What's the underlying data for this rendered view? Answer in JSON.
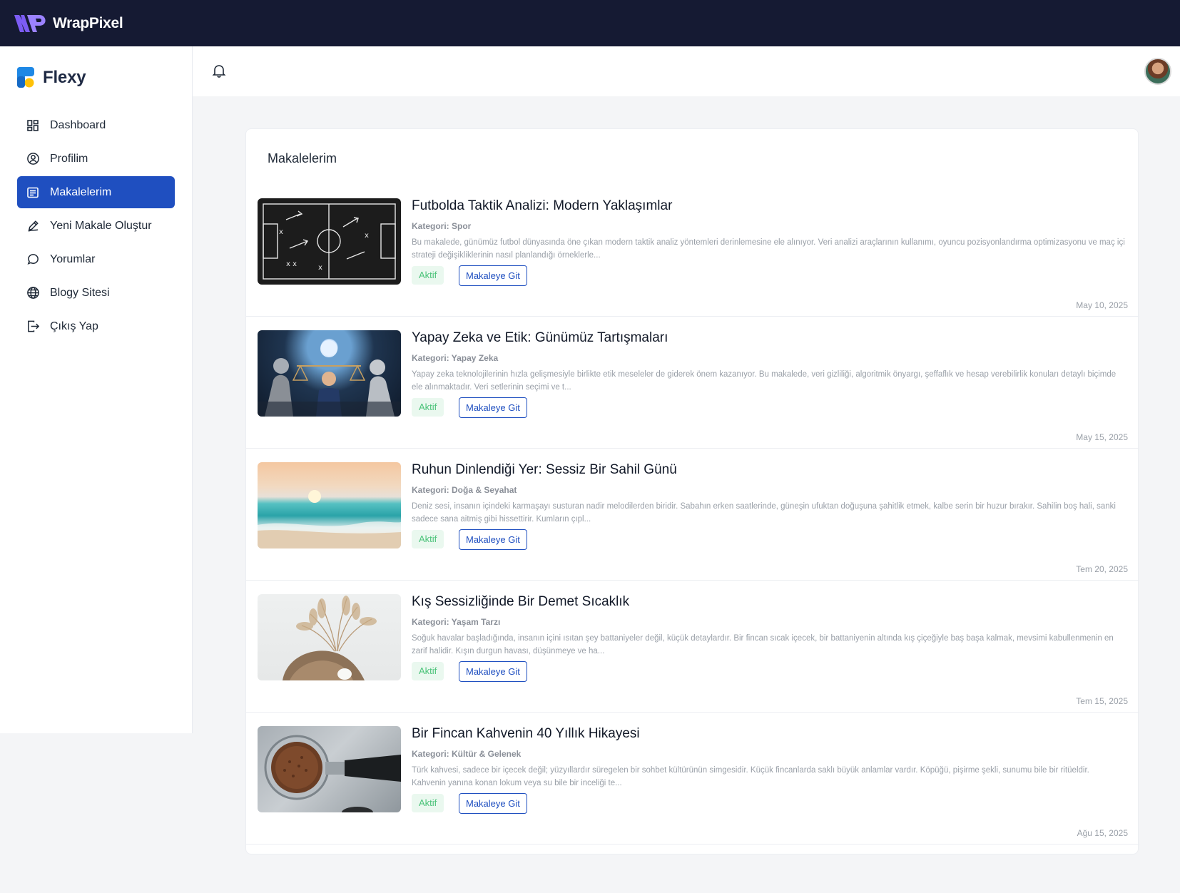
{
  "topbar": {
    "brand": "WrapPixel"
  },
  "sidebar": {
    "brand": "Flexy",
    "items": [
      {
        "label": "Dashboard",
        "icon": "dashboard-icon"
      },
      {
        "label": "Profilim",
        "icon": "user-circle-icon"
      },
      {
        "label": "Makalelerim",
        "icon": "article-icon",
        "active": true
      },
      {
        "label": "Yeni Makale Oluştur",
        "icon": "pencil-icon"
      },
      {
        "label": "Yorumlar",
        "icon": "comment-icon"
      },
      {
        "label": "Blogy Sitesi",
        "icon": "globe-icon"
      },
      {
        "label": "Çıkış Yap",
        "icon": "logout-icon"
      }
    ]
  },
  "header": {
    "bell_icon": "bell-icon",
    "avatar": "user-avatar"
  },
  "main": {
    "title": "Makalelerim",
    "articles": [
      {
        "title": "Futbolda Taktik Analizi: Modern Yaklaşımlar",
        "category": "Kategori: Spor",
        "description": "Bu makalede, günümüz futbol dünyasında öne çıkan modern taktik analiz yöntemleri derinlemesine ele alınıyor. Veri analizi araçlarının kullanımı, oyuncu pozisyonlandırma optimizasyonu ve maç içi strateji değişikliklerinin nasıl planlandığı örneklerle...",
        "status": "Aktif",
        "button": "Makaleye Git",
        "date": "May 10, 2025"
      },
      {
        "title": "Yapay Zeka ve Etik: Günümüz Tartışmaları",
        "category": "Kategori: Yapay Zeka",
        "description": "Yapay zeka teknolojilerinin hızla gelişmesiyle birlikte etik meseleler de giderek önem kazanıyor. Bu makalede, veri gizliliği, algoritmik önyargı, şeffaflık ve hesap verebilirlik konuları detaylı biçimde ele alınmaktadır. Veri setlerinin seçimi ve t...",
        "status": "Aktif",
        "button": "Makaleye Git",
        "date": "May 15, 2025"
      },
      {
        "title": "Ruhun Dinlendiği Yer: Sessiz Bir Sahil Günü",
        "category": "Kategori: Doğa & Seyahat",
        "description": "Deniz sesi, insanın içindeki karmaşayı susturan nadir melodilerden biridir. Sabahın erken saatlerinde, güneşin ufuktan doğuşuna şahitlik etmek, kalbe serin bir huzur bırakır. Sahilin boş hali, sanki sadece sana aitmiş gibi hissettirir. Kumların çıpl...",
        "status": "Aktif",
        "button": "Makaleye Git",
        "date": "Tem 20, 2025"
      },
      {
        "title": "Kış Sessizliğinde Bir Demet Sıcaklık",
        "category": "Kategori: Yaşam Tarzı",
        "description": "Soğuk havalar başladığında, insanın içini ısıtan şey battaniyeler değil, küçük detaylardır. Bir fincan sıcak içecek, bir battaniyenin altında kış çiçeğiyle baş başa kalmak, mevsimi kabullenmenin en zarif halidir. Kışın durgun havası, düşünmeye ve ha...",
        "status": "Aktif",
        "button": "Makaleye Git",
        "date": "Tem 15, 2025"
      },
      {
        "title": "Bir Fincan Kahvenin 40 Yıllık Hikayesi",
        "category": "Kategori: Kültür & Gelenek",
        "description": "Türk kahvesi, sadece bir içecek değil; yüzyıllardır süregelen bir sohbet kültürünün simgesidir. Küçük fincanlarda saklı büyük anlamlar vardır. Köpüğü, pişirme şekli, sunumu bile bir ritüeldir. Kahvenin yanına konan lokum veya su bile bir inceliği te...",
        "status": "Aktif",
        "button": "Makaleye Git",
        "date": "Ağu 15, 2025"
      }
    ]
  },
  "colors": {
    "topbar": "#151a33",
    "accent": "#1f4fc0",
    "status_bg": "#eaf8ef",
    "status_text": "#4cc37a"
  }
}
